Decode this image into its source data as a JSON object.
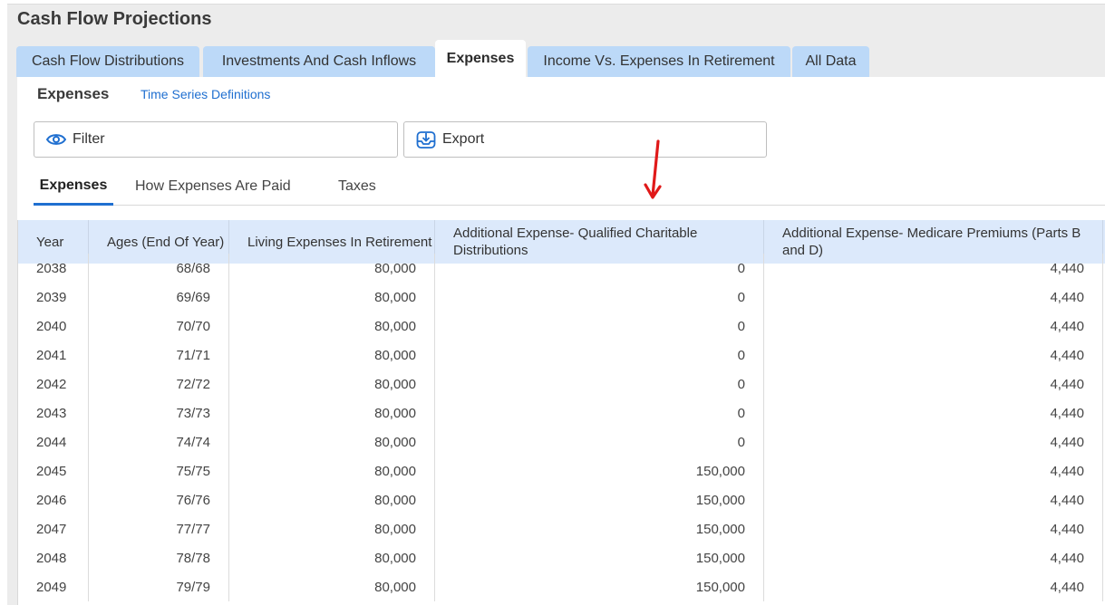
{
  "page": {
    "title": "Cash Flow Projections"
  },
  "tabs": [
    {
      "label": "Cash Flow Distributions"
    },
    {
      "label": "Investments And Cash Inflows"
    },
    {
      "label": "Expenses"
    },
    {
      "label": "Income Vs. Expenses In Retirement"
    },
    {
      "label": "All Data"
    }
  ],
  "section": {
    "title": "Expenses",
    "link": "Time Series Definitions"
  },
  "toolbar": {
    "filter_label": "Filter",
    "filter_icon": "eye-icon",
    "export_label": "Export",
    "export_icon": "export-tray-icon"
  },
  "subtabs": [
    {
      "label": "Expenses"
    },
    {
      "label": "How Expenses Are Paid"
    },
    {
      "label": "Taxes"
    }
  ],
  "colors": {
    "accent": "#1f6fd0",
    "tab_bg": "#bcd9f8",
    "header_bg": "#dce9fb",
    "annotation": "#e01919"
  },
  "table": {
    "headers": [
      "Year",
      "Ages (End Of Year)",
      "Living Expenses In Retirement",
      "Additional Expense- Qualified Charitable Distributions",
      "Additional Expense- Medicare Premiums (Parts B and D)"
    ],
    "rows": [
      [
        "2038",
        "68/68",
        "80,000",
        "0",
        "4,440"
      ],
      [
        "2039",
        "69/69",
        "80,000",
        "0",
        "4,440"
      ],
      [
        "2040",
        "70/70",
        "80,000",
        "0",
        "4,440"
      ],
      [
        "2041",
        "71/71",
        "80,000",
        "0",
        "4,440"
      ],
      [
        "2042",
        "72/72",
        "80,000",
        "0",
        "4,440"
      ],
      [
        "2043",
        "73/73",
        "80,000",
        "0",
        "4,440"
      ],
      [
        "2044",
        "74/74",
        "80,000",
        "0",
        "4,440"
      ],
      [
        "2045",
        "75/75",
        "80,000",
        "150,000",
        "4,440"
      ],
      [
        "2046",
        "76/76",
        "80,000",
        "150,000",
        "4,440"
      ],
      [
        "2047",
        "77/77",
        "80,000",
        "150,000",
        "4,440"
      ],
      [
        "2048",
        "78/78",
        "80,000",
        "150,000",
        "4,440"
      ],
      [
        "2049",
        "79/79",
        "80,000",
        "150,000",
        "4,440"
      ]
    ]
  }
}
